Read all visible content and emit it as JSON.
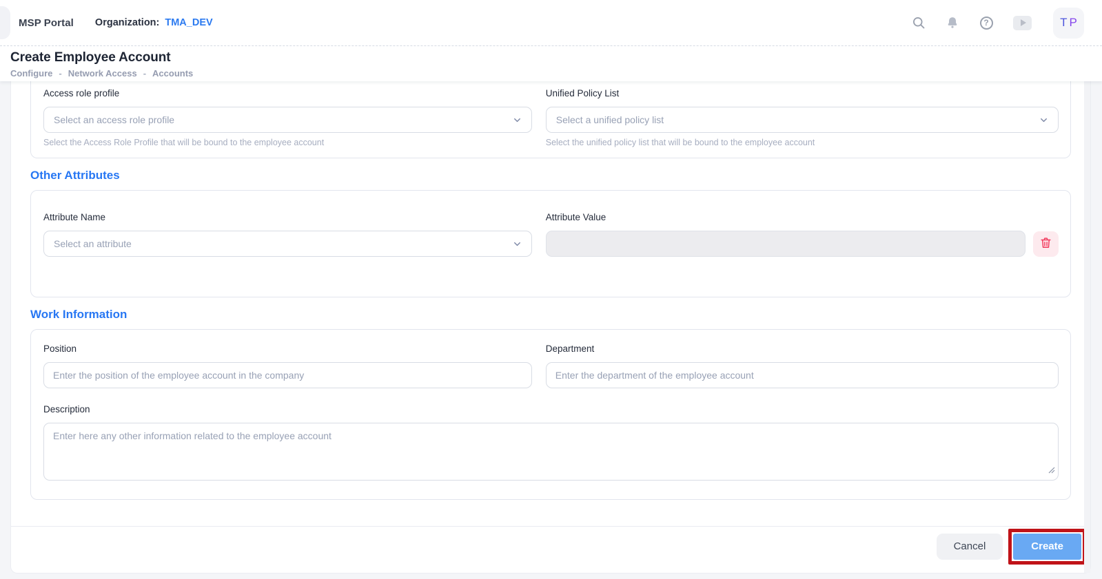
{
  "header": {
    "brand": "MSP Portal",
    "org_label": "Organization:",
    "org_value": "TMA_DEV",
    "avatar": {
      "t": "T",
      "p": "P"
    },
    "help_glyph": "?"
  },
  "page": {
    "title": "Create Employee Account",
    "breadcrumb": {
      "items": [
        "Configure",
        "Network Access",
        "Accounts"
      ],
      "separator": "-"
    }
  },
  "form": {
    "access_role_profile": {
      "label": "Access role profile",
      "placeholder": "Select an access role profile",
      "help": "Select the Access Role Profile that will be bound to the employee account"
    },
    "unified_policy_list": {
      "label": "Unified Policy List",
      "placeholder": "Select a unified policy list",
      "help": "Select the unified policy list that will be bound to the employee account"
    },
    "other_attributes": {
      "heading": "Other Attributes",
      "attribute_name": {
        "label": "Attribute Name",
        "placeholder": "Select an attribute"
      },
      "attribute_value": {
        "label": "Attribute Value",
        "value": ""
      }
    },
    "work_information": {
      "heading": "Work Information",
      "position": {
        "label": "Position",
        "placeholder": "Enter the position of the employee account in the company"
      },
      "department": {
        "label": "Department",
        "placeholder": "Enter the department of the employee account"
      },
      "description": {
        "label": "Description",
        "placeholder": "Enter here any other information related to the employee account"
      }
    }
  },
  "footer": {
    "cancel_label": "Cancel",
    "create_label": "Create"
  },
  "colors": {
    "section_heading": "#2777f3",
    "org_link": "#2b7af0",
    "create_button": "#69a9f3",
    "danger": "#f23c5e",
    "annotation": "#c01318"
  }
}
